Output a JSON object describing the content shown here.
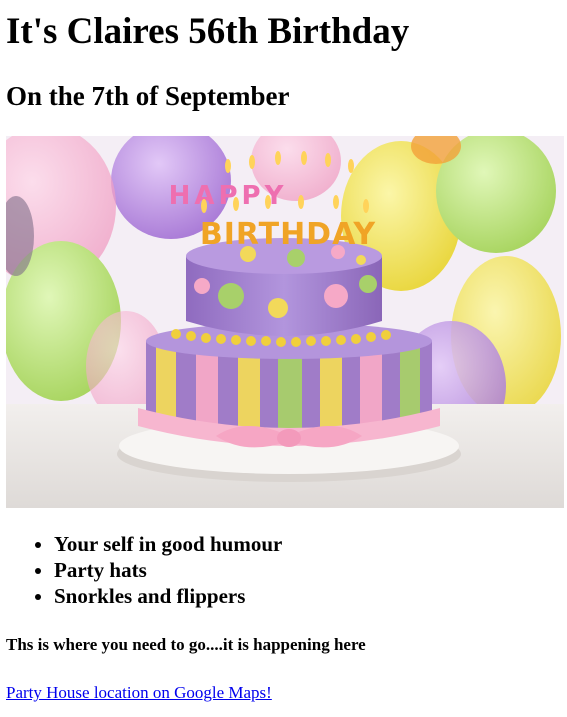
{
  "page": {
    "title": "It's Claires 56th Birthday",
    "subtitle": "On the 7th of September"
  },
  "image": {
    "description_name": "birthday-cake-image",
    "cake_topper_text": [
      "HAPPY",
      "BIRTHDAY"
    ],
    "colors": {
      "bg_light": "#f3eef4",
      "balloon_purple": "#b98be0",
      "balloon_yellow": "#f3e65a",
      "balloon_green": "#b8e07a",
      "balloon_pink": "#f4a3c6",
      "cake_purple": "#a07cc8",
      "stripe_yellow": "#f2d95a",
      "stripe_green": "#a8d06a",
      "stripe_pink": "#f6a9c7",
      "plate": "#f4f1ee",
      "table": "#ece9e6"
    }
  },
  "list": {
    "items": [
      "Your self in good humour",
      "Party hats",
      "Snorkles and flippers"
    ]
  },
  "note": "Ths is where you need to go....it is happening here",
  "link": {
    "label": "Party House location on Google Maps!"
  }
}
